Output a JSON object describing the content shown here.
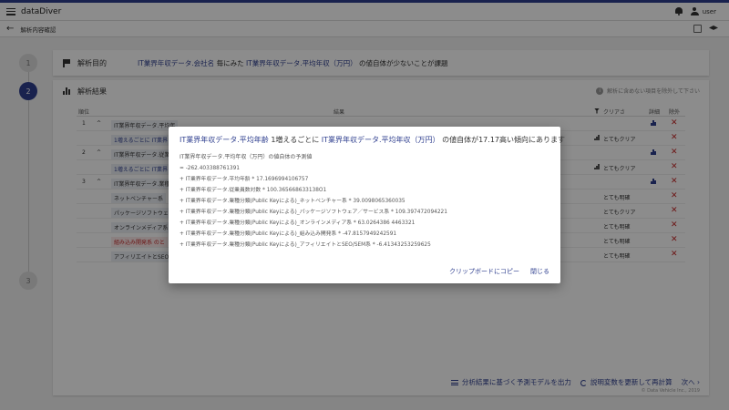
{
  "app": {
    "title": "dataDiver",
    "user": "user"
  },
  "subbar": {
    "breadcrumb": "解析内容確認"
  },
  "steps": [
    "1",
    "2",
    "3"
  ],
  "card1": {
    "title": "解析目的",
    "purpose": {
      "target": "IT業界年収データ.会社名",
      "connector": "毎にみた",
      "metric": "IT業界年収データ.平均年収（万円）",
      "suffix": "の値自体が少ないことが課題"
    }
  },
  "card2": {
    "title": "解析結果",
    "hint": "解析に含めない項目を除外して下さい",
    "columns": {
      "rank": "順位",
      "result": "結果",
      "clarity": "クリアさ",
      "detail": "詳細",
      "exclude": "除外"
    },
    "rows": [
      {
        "rank": "1",
        "chip": "IT業界年収データ.平均年",
        "sub": "1増えるごとに IT業界",
        "clarity": "とてもクリア"
      },
      {
        "rank": "2",
        "chip": "IT業界年収データ.従業",
        "sub": "1増えるごとに IT業界",
        "clarity": "とてもクリア"
      },
      {
        "rank": "3",
        "chip": "IT業界年収データ.業種",
        "sub": "",
        "clarity": ""
      }
    ],
    "subrows": [
      {
        "label": "ネットベンチャー系",
        "clarity": "とても明確"
      },
      {
        "label": "パッケージソフトウェア",
        "clarity": "とてもクリア"
      },
      {
        "label": "オンラインメディア系",
        "clarity": "とても明確"
      },
      {
        "label": "組み込み開発系 のと",
        "clarity": "とても明確"
      },
      {
        "label": "アフィリエイトとSEO/",
        "clarity": "とても明確"
      }
    ],
    "footer": {
      "export": "分析結果に基づく予測モデルを出力",
      "recalc": "説明変数を更新して再計算",
      "next": "次へ"
    },
    "copyright": "© Data Vehicle Inc., 2019"
  },
  "dialog": {
    "title": {
      "var": "IT業界年収データ.平均年齢",
      "mid": "1増えるごとに",
      "target": "IT業界年収データ.平均年収（万円）",
      "suffix": "の値自体が17.17高い傾向にあります"
    },
    "subtitle": "IT業界年収データ.平均年収（万円）の値自体の予測値",
    "terms": [
      "= -262.403388761391",
      "+ IT業界年収データ.平均年齢 * 17.1696994106757",
      "+ IT業界年収データ.従業員数対数 * 100.365668633138O1",
      "+ IT業界年収データ.業種分類(Public Keyによる)_ネットベンチャー系 * 39.0098065360035",
      "+ IT業界年収データ.業種分類(Public Keyによる)_パッケージソフトウェア／サービス系 * 109.397472094221",
      "+ IT業界年収データ.業種分類(Public Keyによる)_オンラインメディア系 * 63.0264386 4463321",
      "+ IT業界年収データ.業種分類(Public Keyによる)_組み込み開発系 * -47.8157949242591",
      "+ IT業界年収データ.業種分類(Public Keyによる)_アフィリエイトとSEO/SEM系 * -6.41343253259625"
    ],
    "copy_label": "クリップボードにコピー",
    "close_label": "閉じる"
  }
}
